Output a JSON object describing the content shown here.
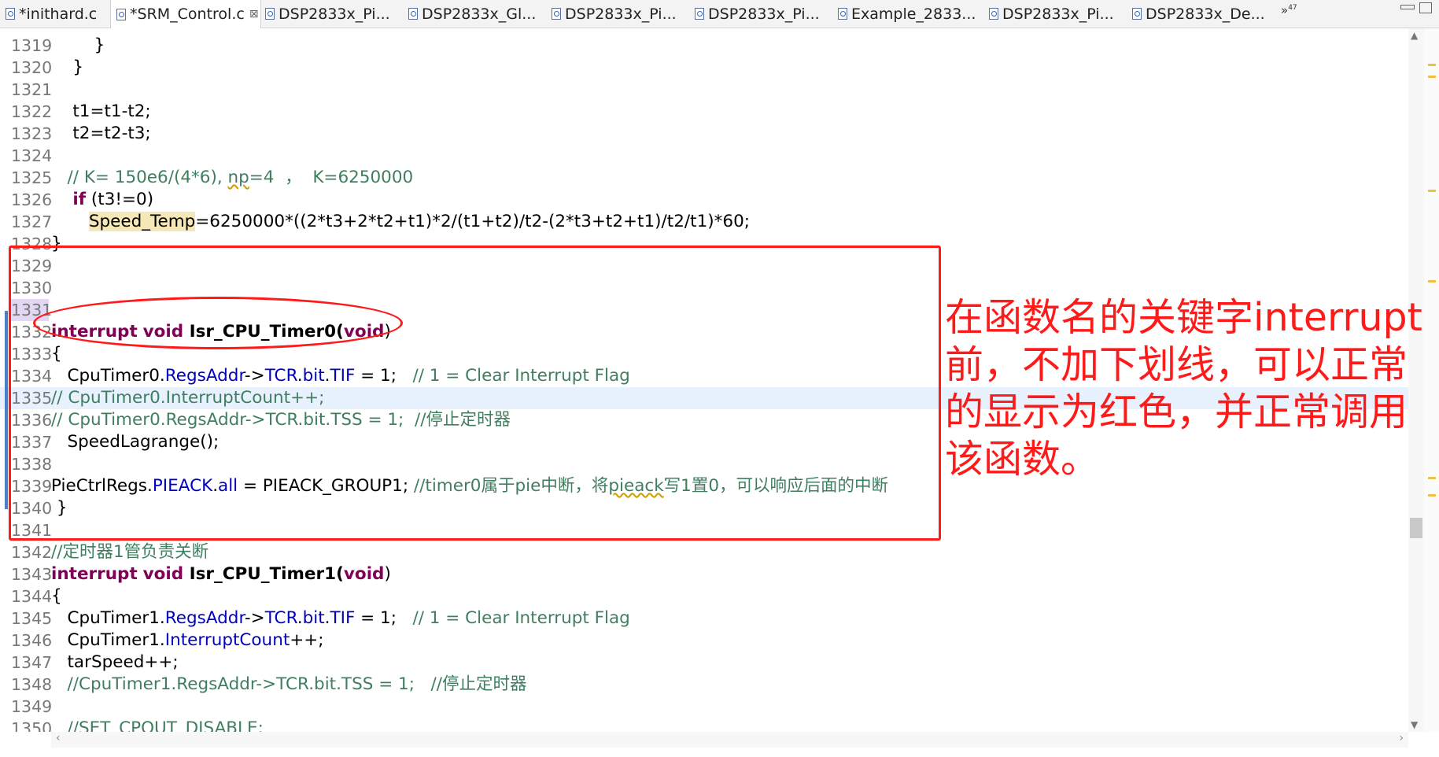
{
  "tabs": [
    {
      "label": "*inithard.c",
      "active": false
    },
    {
      "label": "*SRM_Control.c",
      "active": true,
      "close": "⊠"
    },
    {
      "label": "DSP2833x_Pi...",
      "active": false
    },
    {
      "label": "DSP2833x_Gl...",
      "active": false
    },
    {
      "label": "DSP2833x_Pi...",
      "active": false
    },
    {
      "label": "DSP2833x_Pi...",
      "active": false
    },
    {
      "label": "Example_2833...",
      "active": false
    },
    {
      "label": "DSP2833x_Pi...",
      "active": false
    },
    {
      "label": "DSP2833x_De...",
      "active": false
    }
  ],
  "overflow": {
    "label": "»",
    "count": "47"
  },
  "code_lines": [
    {
      "n": "1319",
      "segs": [
        {
          "t": "        }"
        }
      ]
    },
    {
      "n": "1320",
      "segs": [
        {
          "t": "    }"
        }
      ]
    },
    {
      "n": "1321",
      "segs": []
    },
    {
      "n": "1322",
      "segs": [
        {
          "t": "    t1=t1-t2;"
        }
      ]
    },
    {
      "n": "1323",
      "segs": [
        {
          "t": "    t2=t2-t3;"
        }
      ]
    },
    {
      "n": "1324",
      "segs": []
    },
    {
      "n": "1325",
      "segs": [
        {
          "t": "   // K= 150e6/(4*6), ",
          "c": "cmt"
        },
        {
          "t": "np",
          "c": "cmt sq"
        },
        {
          "t": "=4  ，  K=6250000",
          "c": "cmt"
        }
      ]
    },
    {
      "n": "1326",
      "segs": [
        {
          "t": "    "
        },
        {
          "t": "if",
          "c": "kw"
        },
        {
          "t": " (t3!=0)"
        }
      ]
    },
    {
      "n": "1327",
      "segs": [
        {
          "t": "       "
        },
        {
          "t": "Speed_Temp",
          "c": "hl"
        },
        {
          "t": "=6250000*((2*t3+2*t2+t1)*2/(t1+t2)/t2-(2*t3+t2+t1)/t2/t1)*60;"
        }
      ]
    },
    {
      "n": "1328",
      "segs": [
        {
          "t": "}"
        }
      ]
    },
    {
      "n": "1329",
      "segs": []
    },
    {
      "n": "1330",
      "segs": []
    },
    {
      "n": "1331",
      "segs": [],
      "selnum": true
    },
    {
      "n": "1332",
      "segs": [
        {
          "t": "interrupt",
          "c": "kw"
        },
        {
          "t": " "
        },
        {
          "t": "void",
          "c": "kw"
        },
        {
          "t": " Isr_CPU_Timer0(",
          "c": "fnb"
        },
        {
          "t": "void",
          "c": "kw"
        },
        {
          "t": ")"
        }
      ]
    },
    {
      "n": "1333",
      "segs": [
        {
          "t": "{"
        }
      ]
    },
    {
      "n": "1334",
      "segs": [
        {
          "t": "   CpuTimer0."
        },
        {
          "t": "RegsAddr",
          "c": "fld"
        },
        {
          "t": "->"
        },
        {
          "t": "TCR",
          "c": "fld"
        },
        {
          "t": "."
        },
        {
          "t": "bit",
          "c": "fld"
        },
        {
          "t": "."
        },
        {
          "t": "TIF",
          "c": "fld"
        },
        {
          "t": " = 1;   "
        },
        {
          "t": "// 1 = Clear Interrupt Flag",
          "c": "cmt"
        }
      ]
    },
    {
      "n": "1335",
      "segs": [
        {
          "t": "// CpuTimer0.InterruptCount++;",
          "c": "cmt"
        }
      ],
      "cur": true
    },
    {
      "n": "1336",
      "segs": [
        {
          "t": "// CpuTimer0.RegsAddr->TCR.bit.TSS = 1;  //停止定时器",
          "c": "cmt"
        }
      ]
    },
    {
      "n": "1337",
      "segs": [
        {
          "t": "   SpeedLagrange();"
        }
      ]
    },
    {
      "n": "1338",
      "segs": []
    },
    {
      "n": "1339",
      "segs": [
        {
          "t": "PieCtrlRegs."
        },
        {
          "t": "PIEACK",
          "c": "fld"
        },
        {
          "t": "."
        },
        {
          "t": "all",
          "c": "fld"
        },
        {
          "t": " = PIEACK_GROUP1; "
        },
        {
          "t": "//timer0属于pie中断，将",
          "c": "cmt"
        },
        {
          "t": "pieack",
          "c": "cmt sq"
        },
        {
          "t": "写1置0，可以响应后面的中断",
          "c": "cmt"
        }
      ]
    },
    {
      "n": "1340",
      "segs": [
        {
          "t": " }"
        }
      ]
    },
    {
      "n": "1341",
      "segs": []
    },
    {
      "n": "1342",
      "segs": [
        {
          "t": "//定时器1管负责关断",
          "c": "cmt"
        }
      ]
    },
    {
      "n": "1343",
      "segs": [
        {
          "t": "interrupt",
          "c": "kw"
        },
        {
          "t": " "
        },
        {
          "t": "void",
          "c": "kw"
        },
        {
          "t": " Isr_CPU_Timer1(",
          "c": "fnb"
        },
        {
          "t": "void",
          "c": "kw"
        },
        {
          "t": ")"
        }
      ]
    },
    {
      "n": "1344",
      "segs": [
        {
          "t": "{"
        }
      ]
    },
    {
      "n": "1345",
      "segs": [
        {
          "t": "   CpuTimer1."
        },
        {
          "t": "RegsAddr",
          "c": "fld"
        },
        {
          "t": "->"
        },
        {
          "t": "TCR",
          "c": "fld"
        },
        {
          "t": "."
        },
        {
          "t": "bit",
          "c": "fld"
        },
        {
          "t": "."
        },
        {
          "t": "TIF",
          "c": "fld"
        },
        {
          "t": " = 1;   "
        },
        {
          "t": "// 1 = Clear Interrupt Flag",
          "c": "cmt"
        }
      ]
    },
    {
      "n": "1346",
      "segs": [
        {
          "t": "   CpuTimer1."
        },
        {
          "t": "InterruptCount",
          "c": "fld"
        },
        {
          "t": "++;"
        }
      ]
    },
    {
      "n": "1347",
      "segs": [
        {
          "t": "   tarSpeed++;"
        }
      ]
    },
    {
      "n": "1348",
      "segs": [
        {
          "t": "   //CpuTimer1.RegsAddr->TCR.bit.TSS = 1;   //停止定时器",
          "c": "cmt"
        }
      ]
    },
    {
      "n": "1349",
      "segs": []
    },
    {
      "n": "1350",
      "segs": [
        {
          "t": "   //SET_CPOUT_DISABLE;",
          "c": "cmt"
        }
      ]
    }
  ],
  "annotation": {
    "lines": [
      "在函数名的关键字interrupt",
      "前，不加下划线，可以正常",
      "的显示为红色，并正常调用",
      "该函数。"
    ],
    "color": "#ff1a1a"
  },
  "colors": {
    "keyword": "#7f0055",
    "field": "#0000c0",
    "comment": "#3f7f5f",
    "current_line": "#e8f2fe",
    "occurrence_highlight": "#f5e7b6"
  }
}
